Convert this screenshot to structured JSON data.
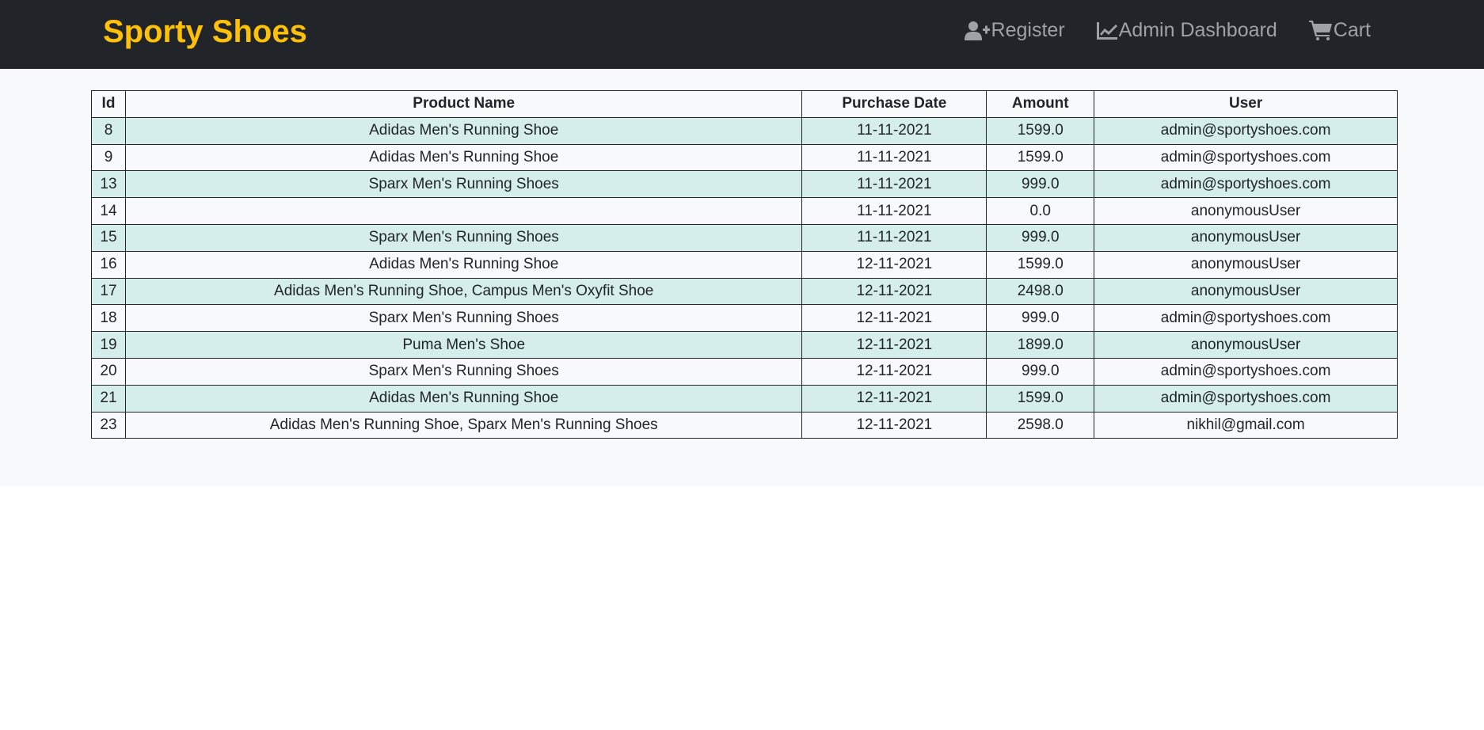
{
  "brand": "Sporty Shoes",
  "nav": {
    "register": {
      "label": "Register",
      "icon": "user-plus-icon"
    },
    "admin": {
      "label": "Admin Dashboard",
      "icon": "chart-line-icon"
    },
    "cart": {
      "label": "Cart",
      "icon": "cart-icon"
    }
  },
  "colors": {
    "navbar_bg": "#212529",
    "brand": "#ffc107",
    "nav_link": "#9ea2a6",
    "stripe": "#d5eeec",
    "page_bg": "#f8f9fa"
  },
  "table": {
    "headers": [
      "Id",
      "Product Name",
      "Purchase Date",
      "Amount",
      "User"
    ],
    "rows": [
      [
        "8",
        "Adidas Men's Running Shoe",
        "11-11-2021",
        "1599.0",
        "admin@sportyshoes.com"
      ],
      [
        "9",
        "Adidas Men's Running Shoe",
        "11-11-2021",
        "1599.0",
        "admin@sportyshoes.com"
      ],
      [
        "13",
        "Sparx Men's Running Shoes",
        "11-11-2021",
        "999.0",
        "admin@sportyshoes.com"
      ],
      [
        "14",
        "",
        "11-11-2021",
        "0.0",
        "anonymousUser"
      ],
      [
        "15",
        "Sparx Men's Running Shoes",
        "11-11-2021",
        "999.0",
        "anonymousUser"
      ],
      [
        "16",
        "Adidas Men's Running Shoe",
        "12-11-2021",
        "1599.0",
        "anonymousUser"
      ],
      [
        "17",
        "Adidas Men's Running Shoe, Campus Men's Oxyfit Shoe",
        "12-11-2021",
        "2498.0",
        "anonymousUser"
      ],
      [
        "18",
        "Sparx Men's Running Shoes",
        "12-11-2021",
        "999.0",
        "admin@sportyshoes.com"
      ],
      [
        "19",
        "Puma Men's Shoe",
        "12-11-2021",
        "1899.0",
        "anonymousUser"
      ],
      [
        "20",
        "Sparx Men's Running Shoes",
        "12-11-2021",
        "999.0",
        "admin@sportyshoes.com"
      ],
      [
        "21",
        "Adidas Men's Running Shoe",
        "12-11-2021",
        "1599.0",
        "admin@sportyshoes.com"
      ],
      [
        "23",
        "Adidas Men's Running Shoe, Sparx Men's Running Shoes",
        "12-11-2021",
        "2598.0",
        "nikhil@gmail.com"
      ]
    ]
  }
}
